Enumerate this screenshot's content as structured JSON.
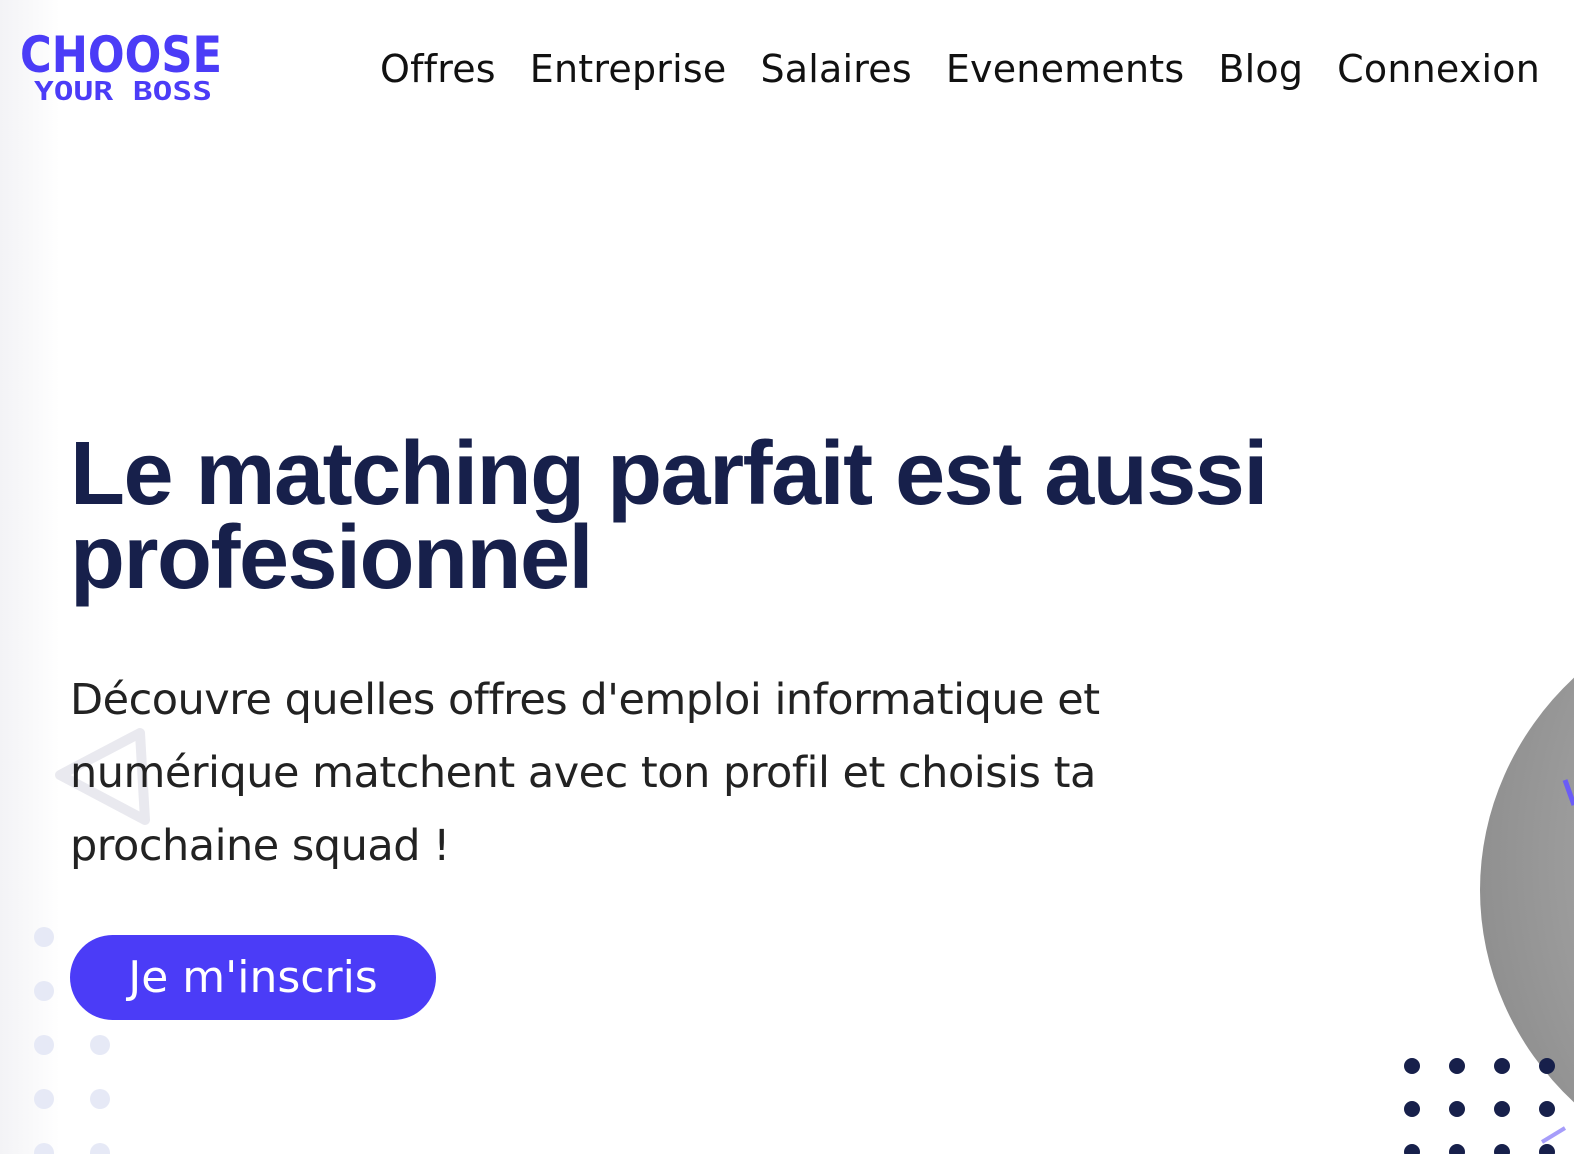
{
  "brand": {
    "logo_line1": "CHOOSE",
    "logo_line2": "YOUR BOSS",
    "color_primary": "#4b3cf7",
    "color_text_dark": "#17204b"
  },
  "nav": {
    "items": [
      "Offres",
      "Entreprise",
      "Salaires",
      "Evenements",
      "Blog",
      "Connexion"
    ]
  },
  "hero": {
    "title": "Le matching parfait est aussi profesionnel",
    "subtitle": "Découvre quelles offres d'emploi informatique et numérique matchent avec ton profil et choisis ta prochaine squad !",
    "cta_label": "Je m'inscris"
  }
}
